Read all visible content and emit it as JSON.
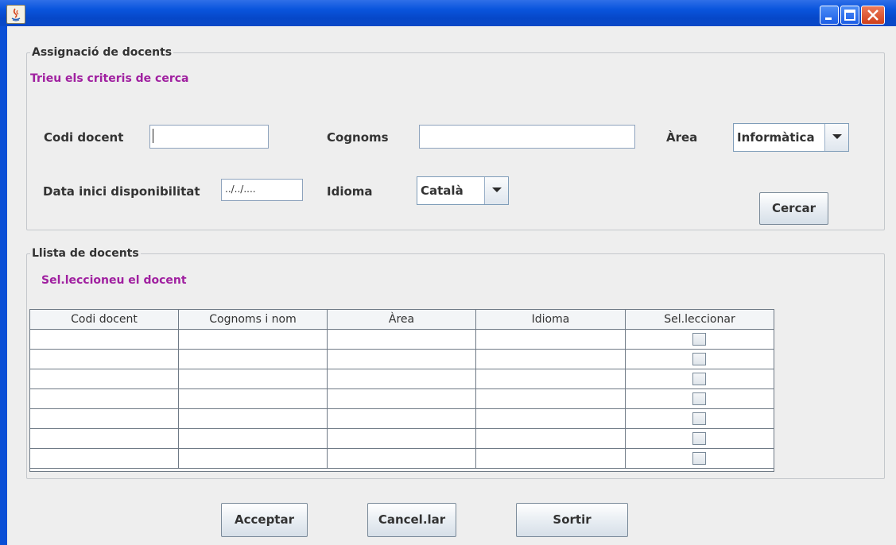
{
  "window": {
    "title": "",
    "app_icon": "java-icon",
    "controls": [
      "minimize-icon",
      "maximize-icon",
      "close-icon"
    ],
    "accent_color": "#0a55dd"
  },
  "search_group": {
    "legend": "Assignació de docents",
    "hint": "Trieu els criteris de cerca",
    "codi_label": "Codi docent",
    "codi_value": "",
    "cognoms_label": "Cognoms",
    "cognoms_value": "",
    "area_label": "Àrea",
    "area_selected": "Informàtica",
    "data_label": "Data inici disponibilitat",
    "data_value": "../../....",
    "idioma_label": "Idioma",
    "idioma_selected": "Català",
    "search_button": "Cercar"
  },
  "list_group": {
    "legend": "Llista de docents",
    "hint": "Sel.leccioneu el docent",
    "columns": [
      "Codi docent",
      "Cognoms i nom",
      "Àrea",
      "Idioma",
      "Sel.leccionar"
    ],
    "rows": [
      [
        "",
        "",
        "",
        "",
        false
      ],
      [
        "",
        "",
        "",
        "",
        false
      ],
      [
        "",
        "",
        "",
        "",
        false
      ],
      [
        "",
        "",
        "",
        "",
        false
      ],
      [
        "",
        "",
        "",
        "",
        false
      ],
      [
        "",
        "",
        "",
        "",
        false
      ],
      [
        "",
        "",
        "",
        "",
        false
      ]
    ]
  },
  "footer": {
    "accept": "Acceptar",
    "cancel": "Cancel.lar",
    "exit": "Sortir"
  },
  "hint_color": "#a020a0"
}
